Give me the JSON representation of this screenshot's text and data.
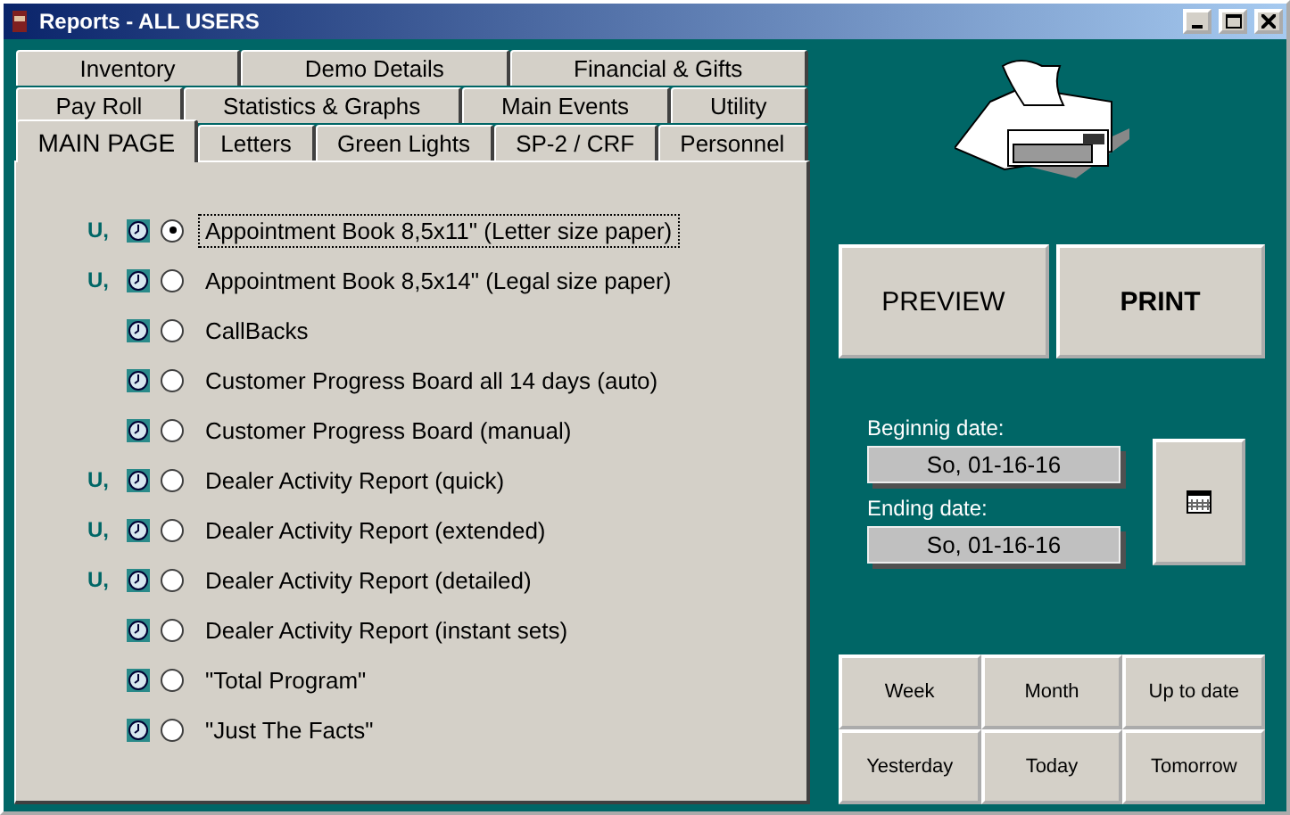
{
  "window": {
    "title": "Reports - ALL USERS"
  },
  "tab_rows": [
    [
      {
        "label": "Inventory",
        "selected": false
      },
      {
        "label": "Demo Details",
        "selected": false
      },
      {
        "label": "Financial & Gifts",
        "selected": false
      }
    ],
    [
      {
        "label": "Pay Roll",
        "selected": false
      },
      {
        "label": "Statistics & Graphs",
        "selected": false
      },
      {
        "label": "Main Events",
        "selected": false
      },
      {
        "label": "Utility",
        "selected": false
      }
    ],
    [
      {
        "label": "MAIN PAGE",
        "selected": true
      },
      {
        "label": "Letters",
        "selected": false
      },
      {
        "label": "Green Lights",
        "selected": false
      },
      {
        "label": "SP-2 / CRF",
        "selected": false
      },
      {
        "label": "Personnel",
        "selected": false
      }
    ]
  ],
  "reports": [
    {
      "prefix": "U,",
      "label": "Appointment Book 8,5x11\" (Letter size paper)",
      "selected": true
    },
    {
      "prefix": "U,",
      "label": "Appointment Book 8,5x14\" (Legal size paper)",
      "selected": false
    },
    {
      "label": "CallBacks",
      "selected": false
    },
    {
      "label": "Customer Progress Board all 14 days (auto)",
      "selected": false
    },
    {
      "label": "Customer Progress Board (manual)",
      "selected": false
    },
    {
      "prefix": "U,",
      "label": "Dealer Activity Report (quick)",
      "selected": false
    },
    {
      "prefix": "U,",
      "label": "Dealer Activity Report (extended)",
      "selected": false
    },
    {
      "prefix": "U,",
      "label": "Dealer Activity Report (detailed)",
      "selected": false
    },
    {
      "label": "Dealer Activity Report (instant sets)",
      "selected": false
    },
    {
      "label": "\"Total Program\"",
      "selected": false
    },
    {
      "label": "\"Just The Facts\"",
      "selected": false
    }
  ],
  "actions": [
    {
      "label": "PREVIEW",
      "bold": false
    },
    {
      "label": "PRINT",
      "bold": true
    }
  ],
  "begin_date": {
    "label": "Beginnig date:",
    "value": "So, 01-16-16"
  },
  "end_date": {
    "label": "Ending date:",
    "value": "So, 01-16-16"
  },
  "ranges": [
    "Week",
    "Month",
    "Up to date",
    "Yesterday",
    "Today",
    "Tomorrow"
  ]
}
